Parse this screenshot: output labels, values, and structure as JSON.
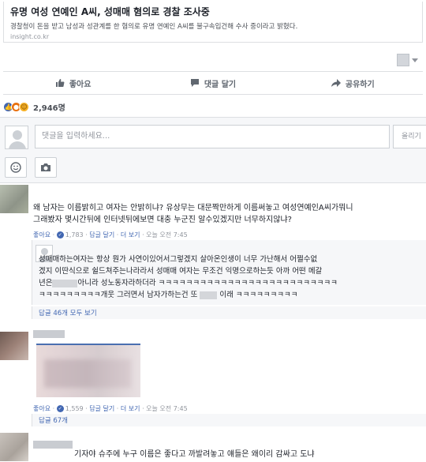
{
  "post": {
    "link_title": "유명 여성 연예인 A씨, 성매매 혐의로 경찰 조사중",
    "link_desc": "경찰청이 돈을 받고 남성과 성관계를 한 혐의로 유명 연예인 A씨를 불구속입건해 수사 중이라고 밝혔다.",
    "link_domain": "insight.co.kr"
  },
  "actions": {
    "like": "좋아요",
    "comment": "댓글 달기",
    "share": "공유하기"
  },
  "reactions": {
    "count": "2,946명",
    "types": [
      "like",
      "angry",
      "haha"
    ]
  },
  "composer": {
    "placeholder": "댓글을 입력하세요...",
    "post_label": "올리기"
  },
  "comments": [
    {
      "line1": "왜 남자는 이름밝히고 여자는 안밝히냐? 유상무는 대문짝만하게 이름써놓고 여성연예인A씨가뭐니",
      "line2": "그래봤자 몇시간뒤에 인터넷뒤에보면 대충 누군진 알수있겠지만 너무하지않냐?",
      "like": "좋아요",
      "likes": "1,783",
      "reply": "답글 달기",
      "more": "더 보기",
      "time": "오늘 오전 7:45"
    },
    {
      "line1": "성매매하는여자는 항상 뭔가 사연이있어서그렇겠지 살아온인생이 너무 가난해서 어쩔수없",
      "line2": "겠지 이딴식으로 쉴드쳐주는나라라서 성매매 여자는 무조건 익명으로하는듯 아까 어떤 메갈",
      "line3a": "년은",
      "line3b": "아니라 성노동자라하더라 ㅋㅋㅋㅋㅋㅋㅋㅋㅋㅋㅋㅋㅋㅋㅋㅋㅋㅋㅋㅋㅋㅋㅋㅋㅋㅋ",
      "line4a": "ㅋㅋㅋㅋㅋㅋㅋㅋㅋ개웃 그러면서 남자가하는건 또",
      "line4b": "이래 ㅋㅋㅋㅋㅋㅋㅋㅋㅋ",
      "replies_link": "답글 46개 모두 보기"
    },
    {
      "like": "좋아요",
      "likes": "1,559",
      "reply": "답글 달기",
      "more": "더 보기",
      "time": "오늘 오전 7:45",
      "replies_link": "답글 67개"
    },
    {
      "line1": "기자야 슈주에 누구 이름은 좋다고 까발려놓고 얘들은 왜이리 감싸고 도냐"
    }
  ]
}
